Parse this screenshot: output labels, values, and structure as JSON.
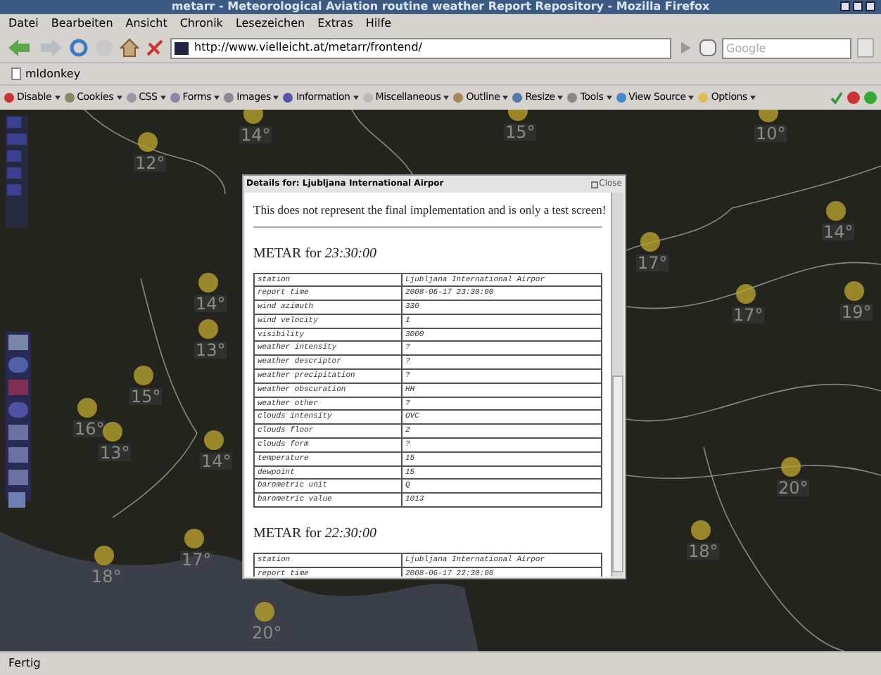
{
  "window": {
    "title": "metarr - Meteorological Aviation routine weather Report Repository - Mozilla Firefox"
  },
  "menu": [
    "Datei",
    "Bearbeiten",
    "Ansicht",
    "Chronik",
    "Lesezeichen",
    "Extras",
    "Hilfe"
  ],
  "address_bar": {
    "value": "http://www.vielleicht.at/metarr/frontend/"
  },
  "search_field": {
    "placeholder": "Google"
  },
  "bookmarks": [
    "mldonkey"
  ],
  "dev_toolbar": [
    "Disable",
    "Cookies",
    "CSS",
    "Forms",
    "Images",
    "Information",
    "Miscellaneous",
    "Outline",
    "Resize",
    "Tools",
    "View Source",
    "Options"
  ],
  "map_labels": [
    "14°",
    "12°",
    "15°",
    "10°",
    "14°",
    "17°",
    "17°",
    "19°",
    "14°",
    "13°",
    "15°",
    "16°",
    "13°",
    "14°",
    "20°",
    "17°",
    "18°",
    "18°",
    "20°"
  ],
  "dialog": {
    "title": "Details for: Ljubljana International Airpor",
    "close": "Close",
    "notice": "This does not represent the final implementation and is only a test screen!",
    "reports": [
      {
        "heading": "METAR for ",
        "time": "23:30:00",
        "rows": [
          [
            "station",
            "Ljubljana International Airpor"
          ],
          [
            "report time",
            "2008-06-17 23:30:00"
          ],
          [
            "wind azimuth",
            "330"
          ],
          [
            "wind velocity",
            "1"
          ],
          [
            "visibility",
            "3000"
          ],
          [
            "weather intensity",
            "?"
          ],
          [
            "weather descriptor",
            "?"
          ],
          [
            "weather precipitation",
            "?"
          ],
          [
            "weather obscuration",
            "HH"
          ],
          [
            "weather other",
            "?"
          ],
          [
            "clouds intensity",
            "OVC"
          ],
          [
            "clouds floor",
            "2"
          ],
          [
            "clouds form",
            "?"
          ],
          [
            "temperature",
            "15"
          ],
          [
            "dewpoint",
            "15"
          ],
          [
            "barometric unit",
            "Q"
          ],
          [
            "barometric value",
            "1013"
          ]
        ]
      },
      {
        "heading": "METAR for ",
        "time": "22:30:00",
        "rows": [
          [
            "station",
            "Ljubljana International Airpor"
          ],
          [
            "report time",
            "2008-06-17 22:30:00"
          ]
        ]
      }
    ]
  },
  "status_bar": {
    "text": "Fertig"
  }
}
